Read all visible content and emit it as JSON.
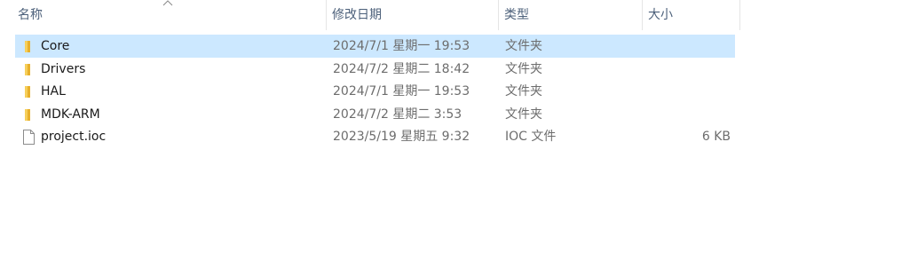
{
  "columns": {
    "name": "名称",
    "date": "修改日期",
    "type": "类型",
    "size": "大小"
  },
  "files": [
    {
      "name": "Core",
      "date": "2024/7/1 星期一 19:53",
      "type": "文件夹",
      "size": "",
      "icon": "folder-icon",
      "selected": true
    },
    {
      "name": "Drivers",
      "date": "2024/7/2 星期二 18:42",
      "type": "文件夹",
      "size": "",
      "icon": "folder-icon",
      "selected": false
    },
    {
      "name": "HAL",
      "date": "2024/7/1 星期一 19:53",
      "type": "文件夹",
      "size": "",
      "icon": "folder-icon",
      "selected": false
    },
    {
      "name": "MDK-ARM",
      "date": "2024/7/2 星期二 3:53",
      "type": "文件夹",
      "size": "",
      "icon": "folder-icon",
      "selected": false
    },
    {
      "name": "project.ioc",
      "date": "2023/5/19 星期五 9:32",
      "type": "IOC 文件",
      "size": "6 KB",
      "icon": "file-icon",
      "selected": false
    }
  ],
  "colors": {
    "selection": "#cce8ff",
    "header_text": "#4c607a",
    "folder": "#f6c343"
  }
}
